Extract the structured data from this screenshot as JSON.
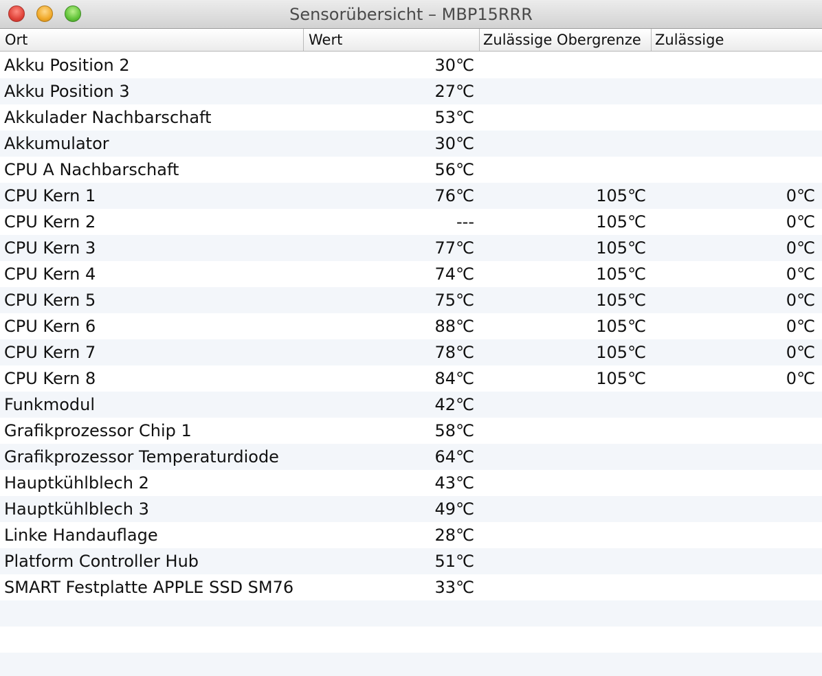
{
  "window": {
    "title": "Sensorübersicht – MBP15RRR"
  },
  "columns": {
    "ort": "Ort",
    "wert": "Wert",
    "max": "Zulässige Obergrenze",
    "min": "Zulässige"
  },
  "rows": [
    {
      "ort": "Akku Position 2",
      "wert": "30℃",
      "max": "",
      "min": ""
    },
    {
      "ort": "Akku Position 3",
      "wert": "27℃",
      "max": "",
      "min": ""
    },
    {
      "ort": "Akkulader Nachbarschaft",
      "wert": "53℃",
      "max": "",
      "min": ""
    },
    {
      "ort": "Akkumulator",
      "wert": "30℃",
      "max": "",
      "min": ""
    },
    {
      "ort": "CPU A Nachbarschaft",
      "wert": "56℃",
      "max": "",
      "min": ""
    },
    {
      "ort": "CPU Kern 1",
      "wert": "76℃",
      "max": "105℃",
      "min": "0℃"
    },
    {
      "ort": "CPU Kern 2",
      "wert": "---",
      "max": "105℃",
      "min": "0℃"
    },
    {
      "ort": "CPU Kern 3",
      "wert": "77℃",
      "max": "105℃",
      "min": "0℃"
    },
    {
      "ort": "CPU Kern 4",
      "wert": "74℃",
      "max": "105℃",
      "min": "0℃"
    },
    {
      "ort": "CPU Kern 5",
      "wert": "75℃",
      "max": "105℃",
      "min": "0℃"
    },
    {
      "ort": "CPU Kern 6",
      "wert": "88℃",
      "max": "105℃",
      "min": "0℃"
    },
    {
      "ort": "CPU Kern 7",
      "wert": "78℃",
      "max": "105℃",
      "min": "0℃"
    },
    {
      "ort": "CPU Kern 8",
      "wert": "84℃",
      "max": "105℃",
      "min": "0℃"
    },
    {
      "ort": "Funkmodul",
      "wert": "42℃",
      "max": "",
      "min": ""
    },
    {
      "ort": "Grafikprozessor Chip 1",
      "wert": "58℃",
      "max": "",
      "min": ""
    },
    {
      "ort": "Grafikprozessor Temperaturdiode",
      "wert": "64℃",
      "max": "",
      "min": ""
    },
    {
      "ort": "Hauptkühlblech 2",
      "wert": "43℃",
      "max": "",
      "min": ""
    },
    {
      "ort": "Hauptkühlblech 3",
      "wert": "49℃",
      "max": "",
      "min": ""
    },
    {
      "ort": "Linke Handauflage",
      "wert": "28℃",
      "max": "",
      "min": ""
    },
    {
      "ort": "Platform Controller Hub",
      "wert": "51℃",
      "max": "",
      "min": ""
    },
    {
      "ort": "SMART Festplatte APPLE SSD SM76",
      "wert": "33℃",
      "max": "",
      "min": ""
    }
  ]
}
